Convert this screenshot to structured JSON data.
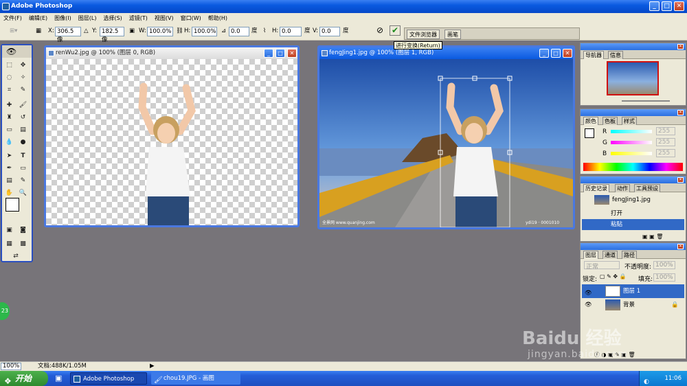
{
  "app": {
    "title": "Adobe Photoshop"
  },
  "menu": [
    "文件(F)",
    "编辑(E)",
    "图像(I)",
    "图层(L)",
    "选择(S)",
    "滤镜(T)",
    "视图(V)",
    "窗口(W)",
    "帮助(H)"
  ],
  "options": {
    "x_label": "X:",
    "x_value": "306.5 像",
    "y_label": "Y:",
    "y_value": "182.5 像",
    "w_label": "W:",
    "w_value": "100.0%",
    "h_label": "H:",
    "h_value": "100.0%",
    "angle_value": "0.0",
    "angle_unit": "度",
    "hskew_label": "H:",
    "hskew_value": "0.0",
    "hskew_unit": "度",
    "vskew_label": "V:",
    "vskew_value": "0.0",
    "vskew_unit": "度",
    "tabs": [
      "文件浏览器",
      "画笔"
    ]
  },
  "tooltip": "进行变换(Return)",
  "documents": {
    "left": {
      "title": "renWu2.jpg @ 100% (图层 0, RGB)"
    },
    "right": {
      "title": "fengJing1.jpg @ 100% (图层 1, RGB)",
      "watermark_left": "全景网 www.quanjing.com",
      "watermark_right": "ydi19 · 0001010"
    }
  },
  "navigator": {
    "tabs": [
      "导航器",
      "信息"
    ]
  },
  "color": {
    "tabs": [
      "颜色",
      "色板",
      "样式"
    ],
    "r_label": "R",
    "g_label": "G",
    "b_label": "B",
    "r_value": "255",
    "g_value": "255",
    "b_value": "255"
  },
  "history": {
    "tabs": [
      "历史记录",
      "动作",
      "工具预设"
    ],
    "snapshot": "fengJing1.jpg",
    "items": [
      "打开",
      "粘贴"
    ]
  },
  "layers": {
    "tabs": [
      "图层",
      "通道",
      "路径"
    ],
    "blend_mode": "正常",
    "opacity_label": "不透明度:",
    "opacity_value": "100%",
    "lock_label": "锁定:",
    "fill_label": "填充:",
    "fill_value": "100%",
    "items": [
      "图层 1",
      "背景"
    ]
  },
  "status": {
    "zoom": "100%",
    "doc_info": "文档:488K/1.05M"
  },
  "taskbar": {
    "start": "开始",
    "tasks": [
      "Adobe Photoshop",
      "chou19.JPG - 画图"
    ],
    "clock": "11:06"
  },
  "badge": "23",
  "baidu": {
    "logo": "Baidu 经验",
    "url": "jingyan.baidu.com"
  }
}
